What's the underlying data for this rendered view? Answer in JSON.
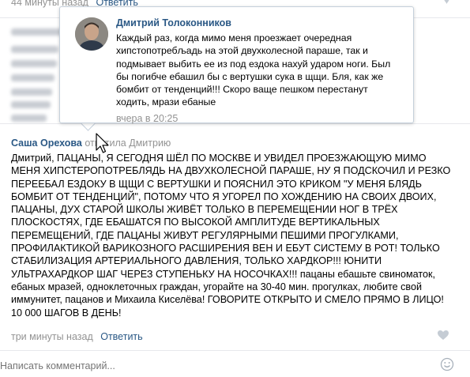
{
  "top_meta": {
    "time": "44 минуты назад",
    "reply_label": "Ответить"
  },
  "popup": {
    "author": "Дмитрий Толоконников",
    "text": "Каждый раз, когда мимо меня проезжает очередная хипстопотребљадь на этой двухколесной параше, так и подмывает выбить ее из под ездока нахуй ударом ноги. Был бы погибче ебашил бы с вертушки сука в щщи. Бля, как же бомбит от тенденций!!! Скоро ваще пешком перестанут ходить, мрази ебаные",
    "time": "вчера в 20:25"
  },
  "comment": {
    "author": "Саша Орехова",
    "action": "ответила Дмитрию",
    "text": "Дмитрий, ПАЦАНЫ, Я СЕГОДНЯ ШЁЛ ПО МОСКВЕ И УВИДЕЛ ПРОЕЗЖАЮЩУЮ МИМО МЕНЯ ХИПСТЕРОПОТРЕБЛЯДЬ НА ДВУХКОЛЕСНОЙ ПАРАШЕ, НУ Я ПОДСКОЧИЛ И РЕЗКО ПЕРЕЕБАЛ ЕЗДОКУ В ЩЩИ С ВЕРТУШКИ И ПОЯСНИЛ ЭТО КРИКОМ \"У МЕНЯ БЛЯДЬ БОМБИТ ОТ ТЕНДЕНЦИЙ\", ПОТОМУ ЧТО Я УГОРЕЛ ПО ХОЖДЕНИЮ НА СВОИХ ДВОИХ, ПАЦАНЫ, ДУХ СТАРОЙ ШКОЛЫ ЖИВЁТ ТОЛЬКО В ПЕРЕМЕЩЕНИИ НОГ В ТРЁХ ПЛОСКОСТЯХ, ГДЕ ЕБАШАТСЯ ПО ВЫСОКОЙ АМПЛИТУДЕ ВЕРТИКАЛЬНЫХ ПЕРЕМЕЩЕНИЙ, ГДЕ ПАЦАНЫ ЖИВУТ РЕГУЛЯРНЫМИ ПЕШИМИ ПРОГУЛКАМИ, ПРОФИЛАКТИКОЙ ВАРИКОЗНОГО РАСШИРЕНИЯ ВЕН И ЕБУТ СИСТЕМУ В РОТ! ТОЛЬКО СТАБИЛИЗАЦИЯ АРТЕРИАЛЬНОГО ДАВЛЕНИЯ, ТОЛЬКО ХАРДКОР!!! ЮНИТИ УЛЬТРАХАРДКОР ШАГ ЧЕРЕЗ СТУПЕНЬКУ НА НОСОЧКАХ!!! пацаны ебашьте свиноматок, ебаных мразей, одноклеточных граждан, угорайте на 30-40 мин. прогулках, любите свой иммунитет, пацанов и Михаила Киселёва! ГОВОРИТЕ ОТКРЫТО И СМЕЛО ПРЯМО В ЛИЦО! 10 000 ШАГОВ В ДЕНЬ!",
    "time": "три минуты назад",
    "reply_label": "Ответить"
  },
  "compose": {
    "placeholder": "Написать комментарий..."
  },
  "icons": {
    "like": "heart-icon",
    "emoji": "smile-icon",
    "cursor": "mouse-pointer-icon"
  },
  "colors": {
    "link": "#2a5885",
    "muted": "#939393",
    "border": "#c5d0db"
  }
}
